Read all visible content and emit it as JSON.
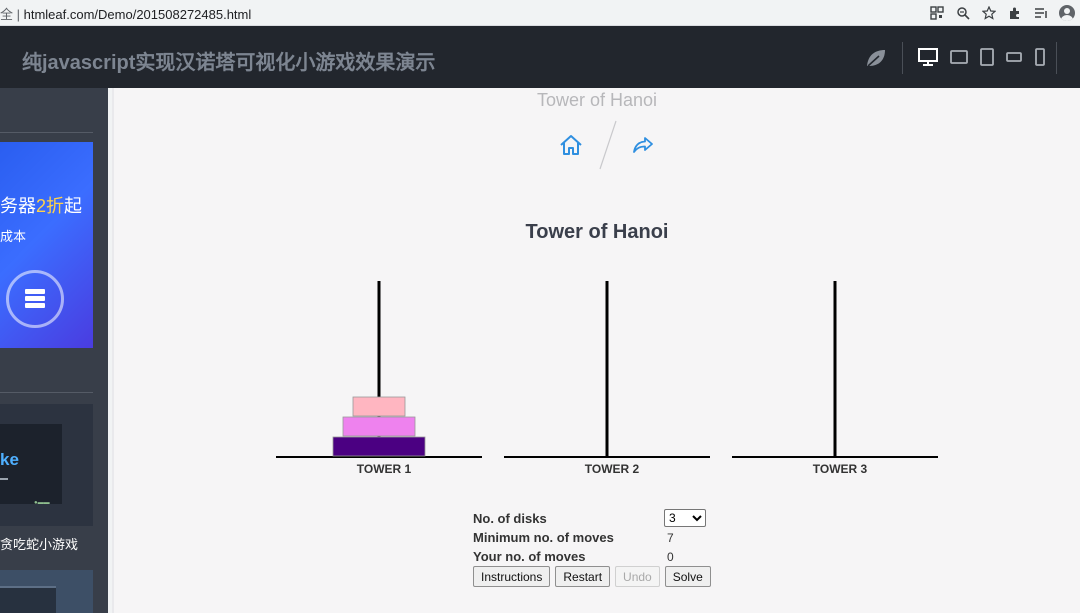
{
  "browser": {
    "security_label": "全 |",
    "url": "htmleaf.com/Demo/201508272485.html",
    "icons": [
      "qr-icon",
      "zoom-icon",
      "star-icon",
      "extensions-icon",
      "playlist-icon",
      "profile-icon"
    ]
  },
  "header": {
    "title": "纯javascript实现汉诺塔可视化小游戏效果演示",
    "logo_icon": "leaf-icon",
    "device_buttons": [
      "desktop-icon",
      "tablet-landscape-icon",
      "tablet-portrait-icon",
      "phone-landscape-icon",
      "phone-portrait-icon"
    ]
  },
  "sidebar": {
    "ad": {
      "line1_prefix": "务器",
      "line1_highlight": "2折",
      "line1_suffix": "起",
      "line2": "成本"
    },
    "thumb_word": "ke",
    "caption": "贪吃蛇小游戏"
  },
  "page": {
    "title": "Tower of Hanoi"
  },
  "game": {
    "title": "Tower of Hanoi",
    "towers": [
      {
        "label": "TOWER 1"
      },
      {
        "label": "TOWER 2"
      },
      {
        "label": "TOWER 3"
      }
    ],
    "disks": [
      {
        "size": 3,
        "tower": 1,
        "color": "#4b0082"
      },
      {
        "size": 2,
        "tower": 1,
        "color": "#ee82ee"
      },
      {
        "size": 1,
        "tower": 1,
        "color": "#ffb6c1"
      }
    ],
    "controls": {
      "disks_label": "No. of disks",
      "disks_value": "3",
      "min_moves_label": "Minimum no. of moves",
      "min_moves_value": "7",
      "your_moves_label": "Your no. of moves",
      "your_moves_value": "0"
    },
    "buttons": {
      "instructions": "Instructions",
      "restart": "Restart",
      "undo": "Undo",
      "solve": "Solve"
    }
  },
  "colors": {
    "header_bg": "#22262d",
    "sidebar_bg": "#383e49",
    "accent_blue": "#2f8fe0"
  }
}
